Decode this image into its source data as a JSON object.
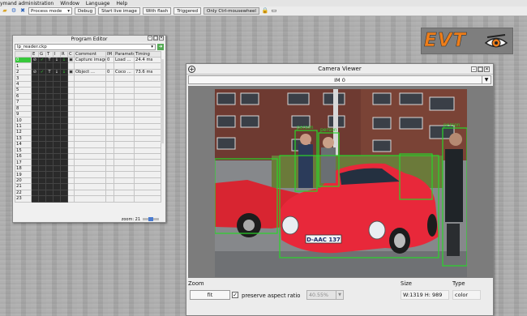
{
  "menubar": {
    "items": [
      "ymand administration",
      "Window",
      "Language",
      "Help"
    ]
  },
  "toolbar": {
    "mode_select": "Process mode",
    "buttons": [
      "Debug",
      "Start live image",
      "With flash",
      "Triggered",
      "Only Ctrl-mousewheel"
    ]
  },
  "logo": {
    "text": "EVT",
    "accent": "#ee7d19"
  },
  "program_editor": {
    "title": "Program Editor",
    "file": "lp_reader.ckp",
    "columns": [
      "",
      "E",
      "G",
      "T",
      "I",
      "R",
      "C",
      "Comment",
      "IM",
      "Parameter",
      "Timing"
    ],
    "rows": [
      {
        "num": "0",
        "comment": "Capture image",
        "im": "0",
        "param": "Load ...",
        "timing": "24.4 ms",
        "selected": true
      },
      {
        "num": "1"
      },
      {
        "num": "2",
        "comment": "Object ...",
        "im": "0",
        "param": "Coco ...",
        "timing": "73.6 ms"
      },
      {
        "num": "3"
      },
      {
        "num": "4"
      },
      {
        "num": "5"
      },
      {
        "num": "6"
      },
      {
        "num": "7"
      },
      {
        "num": "8"
      },
      {
        "num": "9"
      },
      {
        "num": "10"
      },
      {
        "num": "11"
      },
      {
        "num": "12"
      },
      {
        "num": "13"
      },
      {
        "num": "14"
      },
      {
        "num": "15"
      },
      {
        "num": "16"
      },
      {
        "num": "17"
      },
      {
        "num": "18"
      },
      {
        "num": "19"
      },
      {
        "num": "20"
      },
      {
        "num": "21"
      },
      {
        "num": "22"
      },
      {
        "num": "23"
      }
    ],
    "zoom_label": "zoom: 21"
  },
  "camera_viewer": {
    "title": "Camera Viewer",
    "image_select": "IM 0",
    "detections": [
      "person",
      "person",
      "person"
    ],
    "plate": "D-AAC 137",
    "zoom_label": "Zoom",
    "fit_button": "fit",
    "preserve_label": "preserve aspect ratio",
    "preserve_checked": true,
    "zoom_value": "40.55%",
    "size_label": "Size",
    "size_value": "W:1319  H: 989",
    "type_label": "Type",
    "type_value": "color"
  }
}
